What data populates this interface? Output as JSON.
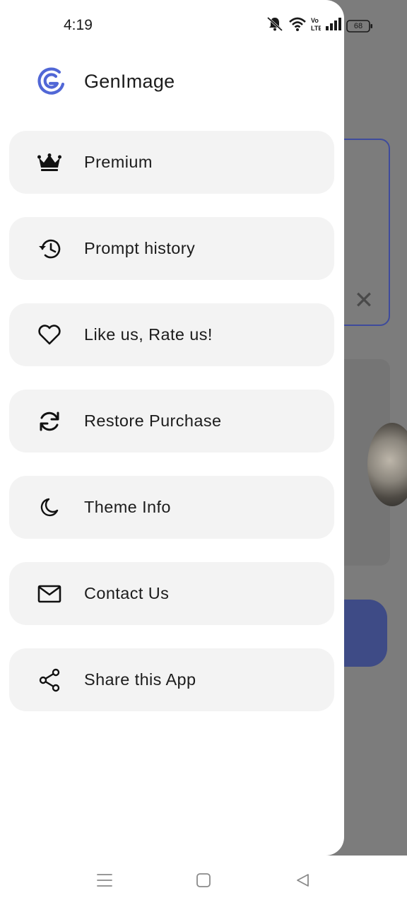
{
  "status_bar": {
    "time": "4:19",
    "battery": "68",
    "icons": [
      "mute-icon",
      "wifi-icon",
      "volte-icon",
      "signal-icon",
      "battery-icon"
    ]
  },
  "drawer": {
    "app_name": "GenImage",
    "brand_color": "#5167d6",
    "items": [
      {
        "label": "Premium",
        "icon": "crown-icon"
      },
      {
        "label": "Prompt history",
        "icon": "history-icon"
      },
      {
        "label": "Like us, Rate us!",
        "icon": "heart-icon"
      },
      {
        "label": "Restore Purchase",
        "icon": "refresh-icon"
      },
      {
        "label": "Theme Info",
        "icon": "moon-icon"
      },
      {
        "label": "Contact Us",
        "icon": "mail-icon"
      },
      {
        "label": "Share this App",
        "icon": "share-icon"
      }
    ]
  },
  "background": {
    "close_symbol": "✕"
  },
  "nav_bar": {
    "buttons": [
      "menu-nav-icon",
      "home-nav-icon",
      "back-nav-icon"
    ]
  }
}
